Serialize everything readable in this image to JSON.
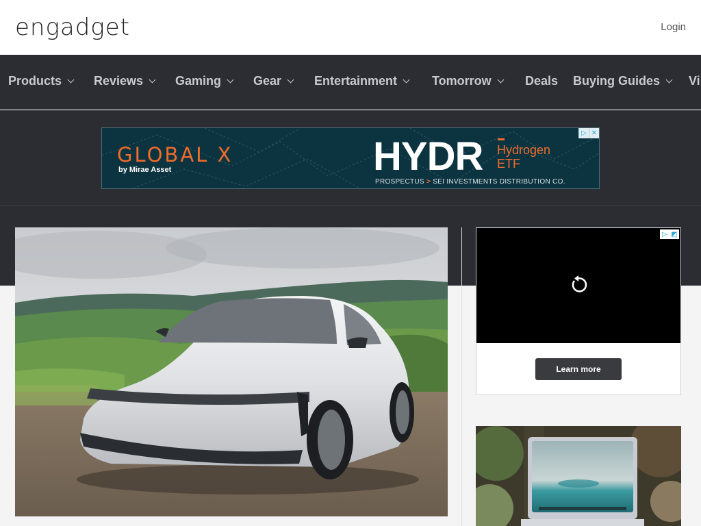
{
  "header": {
    "logo_text": "engadget",
    "login_label": "Login"
  },
  "nav": {
    "items": [
      {
        "label": "Products",
        "has_dropdown": true
      },
      {
        "label": "Reviews",
        "has_dropdown": true
      },
      {
        "label": "Gaming",
        "has_dropdown": true
      },
      {
        "label": "Gear",
        "has_dropdown": true
      },
      {
        "label": "Entertainment",
        "has_dropdown": true
      },
      {
        "label": "Tomorrow",
        "has_dropdown": true
      },
      {
        "label": "Deals",
        "has_dropdown": false
      },
      {
        "label": "Buying Guides",
        "has_dropdown": true
      },
      {
        "label": "Vi",
        "has_dropdown": false
      }
    ]
  },
  "banner_ad": {
    "brand": "GLOBAL X",
    "brand_sub": "by Mirae Asset",
    "ticker": "HYDR",
    "ticker_desc": "Hydrogen ETF",
    "prospectus_label": "PROSPECTUS",
    "prospectus_gt": ">",
    "distributor": "SEI INVESTMENTS DISTRIBUTION CO.",
    "adchoice_icons": [
      "adchoices-icon",
      "close-icon"
    ]
  },
  "hero": {
    "image_subject": "white electric sedan on hillside"
  },
  "video_ad": {
    "learn_more_label": "Learn more",
    "replay_icon": "replay-icon"
  },
  "side_card": {
    "image_subject": "laptop on outdoor table"
  },
  "colors": {
    "nav_bg": "#2b2d33",
    "nav_text": "#c9cacd",
    "accent_orange": "#f26b2a",
    "banner_bg": "#0c3440"
  }
}
